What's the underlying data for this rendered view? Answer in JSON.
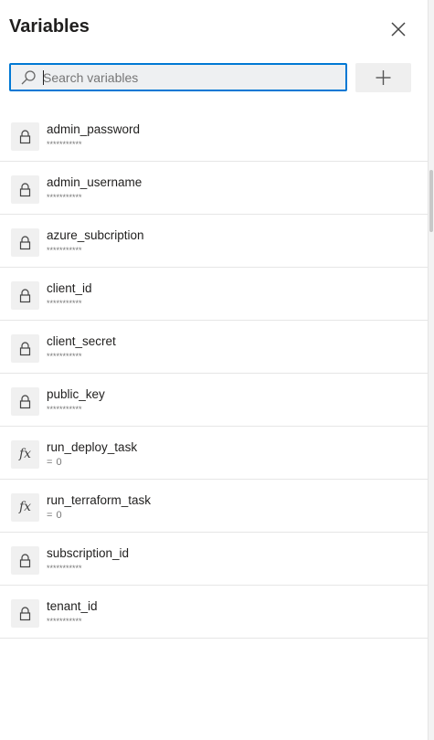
{
  "panel": {
    "title": "Variables",
    "search": {
      "placeholder": "Search variables",
      "value": ""
    },
    "add_button_icon": "plus-icon",
    "close_icon": "close-icon"
  },
  "variables": [
    {
      "name": "admin_password",
      "value": "***********",
      "kind": "secret",
      "icon": "lock-icon"
    },
    {
      "name": "admin_username",
      "value": "***********",
      "kind": "secret",
      "icon": "lock-icon"
    },
    {
      "name": "azure_subcription",
      "value": "***********",
      "kind": "secret",
      "icon": "lock-icon"
    },
    {
      "name": "client_id",
      "value": "***********",
      "kind": "secret",
      "icon": "lock-icon"
    },
    {
      "name": "client_secret",
      "value": "***********",
      "kind": "secret",
      "icon": "lock-icon"
    },
    {
      "name": "public_key",
      "value": "***********",
      "kind": "secret",
      "icon": "lock-icon"
    },
    {
      "name": "run_deploy_task",
      "value": "= 0",
      "kind": "expression",
      "icon": "fx-icon"
    },
    {
      "name": "run_terraform_task",
      "value": "= 0",
      "kind": "expression",
      "icon": "fx-icon"
    },
    {
      "name": "subscription_id",
      "value": "***********",
      "kind": "secret",
      "icon": "lock-icon"
    },
    {
      "name": "tenant_id",
      "value": "***********",
      "kind": "secret",
      "icon": "lock-icon"
    }
  ],
  "colors": {
    "accent": "#0078d4",
    "search_bg": "#eef0f2",
    "button_bg": "#efefef"
  }
}
